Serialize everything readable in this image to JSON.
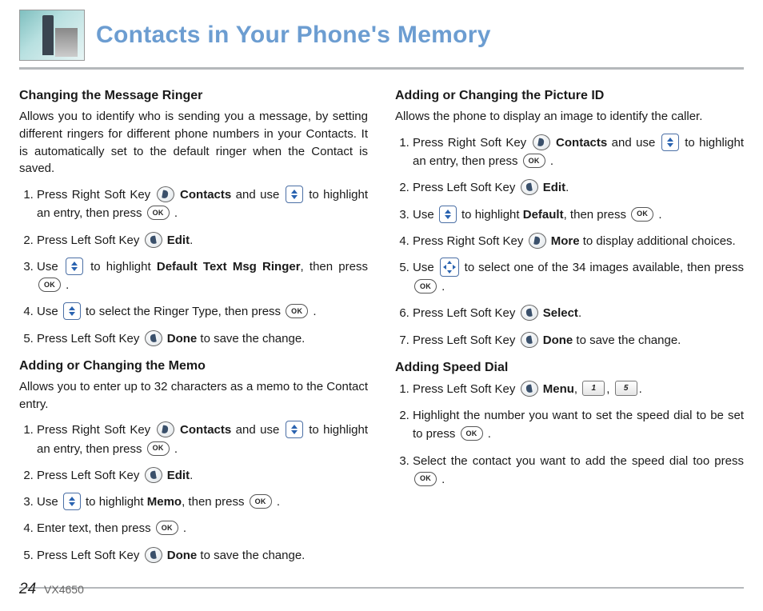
{
  "page_title": "Contacts in Your Phone's Memory",
  "footer": {
    "page_number": "24",
    "model": "VX4650"
  },
  "icons": {
    "ok_label": "OK",
    "key1": "1",
    "key5": "5"
  },
  "left": {
    "sec1": {
      "title": "Changing the Message Ringer",
      "intro": "Allows you to identify who is sending you a message, by setting different ringers for different phone numbers in your Contacts. It is automatically set to the default ringer when the Contact is saved.",
      "steps": {
        "s1": {
          "a": "Press Right Soft Key ",
          "b": "Contacts",
          "c": " and use ",
          "d": " to highlight an entry, then press ",
          "e": "."
        },
        "s2": {
          "a": "Press Left Soft Key ",
          "b": "Edit",
          "c": "."
        },
        "s3": {
          "a": "Use ",
          "b": " to highlight ",
          "c": "Default Text Msg Ringer",
          "d": ", then press ",
          "e": "."
        },
        "s4": {
          "a": "Use ",
          "b": " to select the Ringer Type, then press ",
          "c": "."
        },
        "s5": {
          "a": "Press Left Soft Key ",
          "b": "Done",
          "c": " to save the change."
        }
      }
    },
    "sec2": {
      "title": "Adding or Changing the Memo",
      "intro": "Allows you to enter up to 32 characters as a memo to the Contact entry.",
      "steps": {
        "s1": {
          "a": "Press Right Soft Key ",
          "b": "Contacts",
          "c": " and use ",
          "d": " to highlight an entry, then press ",
          "e": "."
        },
        "s2": {
          "a": "Press Left Soft Key ",
          "b": "Edit",
          "c": "."
        },
        "s3": {
          "a": "Use ",
          "b": " to highlight ",
          "c": "Memo",
          "d": ", then press ",
          "e": "."
        },
        "s4": {
          "a": "Enter text, then press ",
          "b": "."
        },
        "s5": {
          "a": "Press Left Soft Key ",
          "b": "Done",
          "c": " to save the change."
        }
      }
    }
  },
  "right": {
    "sec1": {
      "title": "Adding or Changing the Picture ID",
      "intro": "Allows the phone to display an image to identify the caller.",
      "steps": {
        "s1": {
          "a": "Press Right Soft Key ",
          "b": "Contacts",
          "c": " and use ",
          "d": " to highlight an entry, then press ",
          "e": "."
        },
        "s2": {
          "a": "Press Left Soft Key ",
          "b": "Edit",
          "c": "."
        },
        "s3": {
          "a": "Use ",
          "b": " to highlight ",
          "c": "Default",
          "d": ", then press ",
          "e": "."
        },
        "s4": {
          "a": "Press Right Soft Key ",
          "b": "More",
          "c": " to display additional choices."
        },
        "s5": {
          "a": "Use ",
          "b": " to select one of the 34 images available, then press ",
          "c": "."
        },
        "s6": {
          "a": "Press Left Soft Key ",
          "b": "Select",
          "c": "."
        },
        "s7": {
          "a": "Press Left Soft Key ",
          "b": "Done",
          "c": " to save the change."
        }
      }
    },
    "sec2": {
      "title": "Adding Speed Dial",
      "steps": {
        "s1": {
          "a": "Press Left Soft Key ",
          "b": "Menu",
          "c": ", ",
          "d": ", ",
          "e": "."
        },
        "s2": {
          "a": "Highlight the number you want to set the speed dial to be set to press ",
          "b": "."
        },
        "s3": {
          "a": "Select the contact you want to add the speed dial too press ",
          "b": "."
        }
      }
    }
  }
}
